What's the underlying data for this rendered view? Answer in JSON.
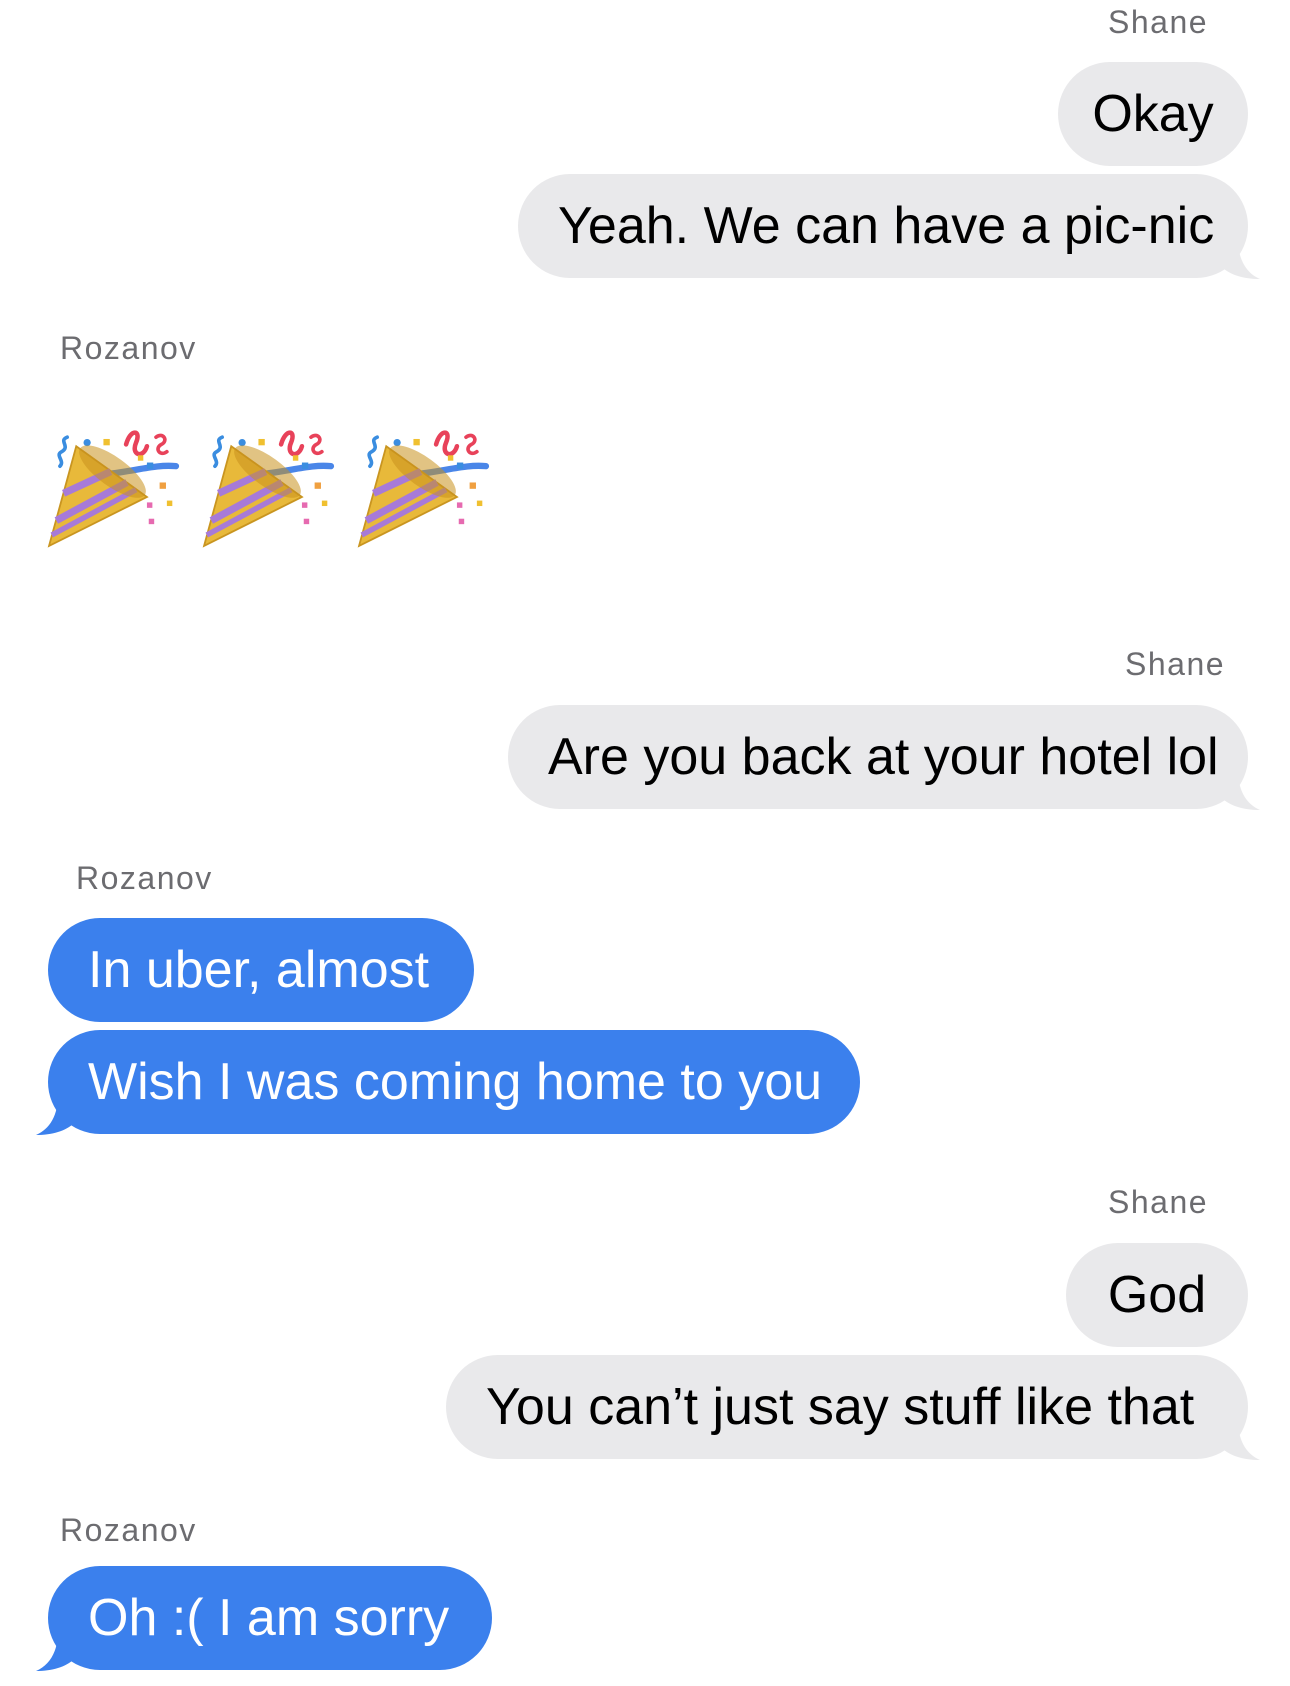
{
  "colors": {
    "incoming_bubble": "#e9e9eb",
    "outgoing_bubble": "#3b80ed",
    "sender_label": "#6c6c70",
    "background": "#ffffff"
  },
  "thread": [
    {
      "sender": "Shane",
      "messages": [
        "Okay",
        "Yeah. We can have a pic-nic"
      ]
    },
    {
      "sender": "Rozanov",
      "emoji": [
        "party-popper-icon",
        "party-popper-icon",
        "party-popper-icon"
      ]
    },
    {
      "sender": "Shane",
      "messages": [
        "Are you back at your hotel lol"
      ]
    },
    {
      "sender": "Rozanov",
      "messages": [
        "In uber, almost",
        "Wish I was coming home to you"
      ]
    },
    {
      "sender": "Shane",
      "messages": [
        "God",
        "You can’t just say stuff like that"
      ]
    },
    {
      "sender": "Rozanov",
      "messages": [
        "Oh :( I am sorry"
      ]
    }
  ]
}
